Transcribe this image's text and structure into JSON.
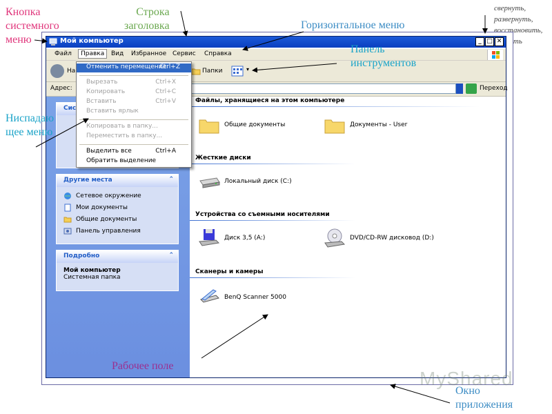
{
  "annotations": {
    "system_menu_button": [
      "Кнопка",
      "системного",
      "меню"
    ],
    "title_bar": [
      "Строка",
      "заголовка"
    ],
    "horizontal_menu": "Горизонтальное меню",
    "window_controls": [
      "свернуть,",
      "развернуть,",
      "восстановить,",
      "закрыть"
    ],
    "toolbar": [
      "Панель",
      "инструментов"
    ],
    "dropdown_menu": [
      "Ниспадаю",
      "щее меню"
    ],
    "work_area": "Рабочее поле",
    "app_window": [
      "Окно",
      "приложения"
    ]
  },
  "window": {
    "title": "Мой компьютер",
    "controls": {
      "minimize": "_",
      "maximize": "□",
      "close": "✕"
    }
  },
  "menubar": {
    "items": [
      "Файл",
      "Правка",
      "Вид",
      "Избранное",
      "Сервис",
      "Справка"
    ],
    "active_index": 1
  },
  "toolbar": {
    "back_label": "На",
    "folders_label": "Папки"
  },
  "address": {
    "label": "Адрес:",
    "go_label": "Переход"
  },
  "dropdown": {
    "groups": [
      [
        {
          "label": "Отменить перемещение",
          "shortcut": "Ctrl+Z",
          "enabled": true,
          "highlight": true
        }
      ],
      [
        {
          "label": "Вырезать",
          "shortcut": "Ctrl+X",
          "enabled": false
        },
        {
          "label": "Копировать",
          "shortcut": "Ctrl+C",
          "enabled": false
        },
        {
          "label": "Вставить",
          "shortcut": "Ctrl+V",
          "enabled": false
        },
        {
          "label": "Вставить ярлык",
          "shortcut": "",
          "enabled": false
        }
      ],
      [
        {
          "label": "Копировать в папку...",
          "shortcut": "",
          "enabled": false
        },
        {
          "label": "Переместить в папку...",
          "shortcut": "",
          "enabled": false
        }
      ],
      [
        {
          "label": "Выделить все",
          "shortcut": "Ctrl+A",
          "enabled": true
        },
        {
          "label": "Обратить выделение",
          "shortcut": "",
          "enabled": true
        }
      ]
    ]
  },
  "left_panels": {
    "system_tasks_partial": "Сис",
    "other_places": {
      "title": "Другие места",
      "items": [
        "Сетевое окружение",
        "Мои документы",
        "Общие документы",
        "Панель управления"
      ]
    },
    "details": {
      "title": "Подробно",
      "name": "Мой компьютер",
      "type": "Системная папка"
    }
  },
  "sections": [
    {
      "title": "Файлы, хранящиеся на этом компьютере",
      "items": [
        "Общие документы",
        "Документы - User"
      ]
    },
    {
      "title": "Жесткие диски",
      "items": [
        "Локальный диск (C:)"
      ]
    },
    {
      "title": "Устройства со съемными носителями",
      "items": [
        "Диск 3,5 (A:)",
        "DVD/CD-RW дисковод (D:)"
      ]
    },
    {
      "title": "Сканеры и камеры",
      "items": [
        "BenQ Scanner 5000"
      ]
    }
  ],
  "watermark": "MyShared",
  "colors": {
    "title_bar": "#0a3fc0",
    "menu_bg": "#ece9d8",
    "panel_bg": "#6b8fe0",
    "highlight": "#316ac5"
  }
}
